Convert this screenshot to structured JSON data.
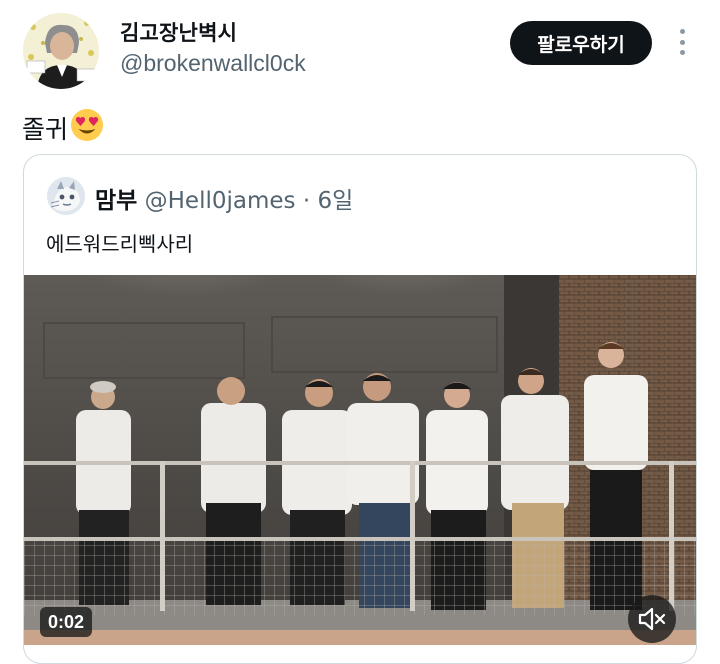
{
  "author": {
    "name": "김고장난벽시",
    "handle": "@brokenwallcl0ck"
  },
  "follow_label": "팔로우하기",
  "more_icon": "more-vertical-icon",
  "tweet": {
    "text": "졸귀",
    "emoji": "heart-eyes-emoji"
  },
  "quote": {
    "name": "맘부",
    "handle": "@Hell0james",
    "separator": "·",
    "time": "6일",
    "text": "에드워드리삑사리"
  },
  "video": {
    "duration": "0:02",
    "mute_icon": "speaker-muted-icon"
  },
  "colors": {
    "follow_bg": "#0f1419",
    "secondary_text": "#536471",
    "border": "#cfd9de"
  }
}
